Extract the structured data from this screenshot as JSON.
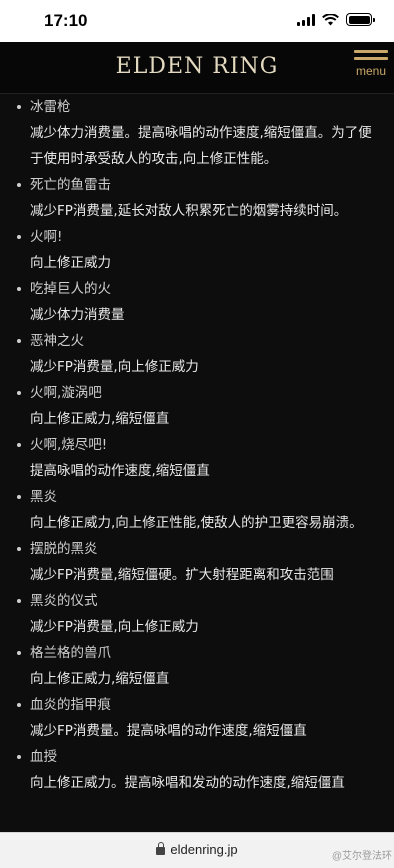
{
  "status_bar": {
    "time": "17:10"
  },
  "header": {
    "logo": "ELDEN RING",
    "menu_label": "menu"
  },
  "entries": [
    {
      "title": "冰雷枪",
      "desc": "减少体力消费量。提高咏唱的动作速度,缩短僵直。为了便于使用时承受敌人的攻击,向上修正性能。"
    },
    {
      "title": "死亡的鱼雷击",
      "desc": "减少FP消费量,延长对敌人积累死亡的烟雾持续时间。"
    },
    {
      "title": "火啊!",
      "desc": "向上修正威力"
    },
    {
      "title": "吃掉巨人的火",
      "desc": "减少体力消费量"
    },
    {
      "title": "恶神之火",
      "desc": "减少FP消费量,向上修正威力"
    },
    {
      "title": "火啊,漩涡吧",
      "desc": "向上修正威力,缩短僵直"
    },
    {
      "title": "火啊,烧尽吧!",
      "desc": "提高咏唱的动作速度,缩短僵直"
    },
    {
      "title": "黑炎",
      "desc": "向上修正威力,向上修正性能,使敌人的护卫更容易崩溃。"
    },
    {
      "title": "摆脱的黑炎",
      "desc": "减少FP消费量,缩短僵硬。扩大射程距离和攻击范围"
    },
    {
      "title": "黑炎的仪式",
      "desc": "减少FP消费量,向上修正威力"
    },
    {
      "title": "格兰格的兽爪",
      "desc": "向上修正威力,缩短僵直"
    },
    {
      "title": "血炎的指甲痕",
      "desc": "减少FP消费量。提高咏唱的动作速度,缩短僵直"
    },
    {
      "title": "血授",
      "desc": "向上修正威力。提高咏唱和发动的动作速度,缩短僵直"
    }
  ],
  "url_bar": {
    "url": "eldenring.jp"
  },
  "watermark": "@艾尔登法环"
}
